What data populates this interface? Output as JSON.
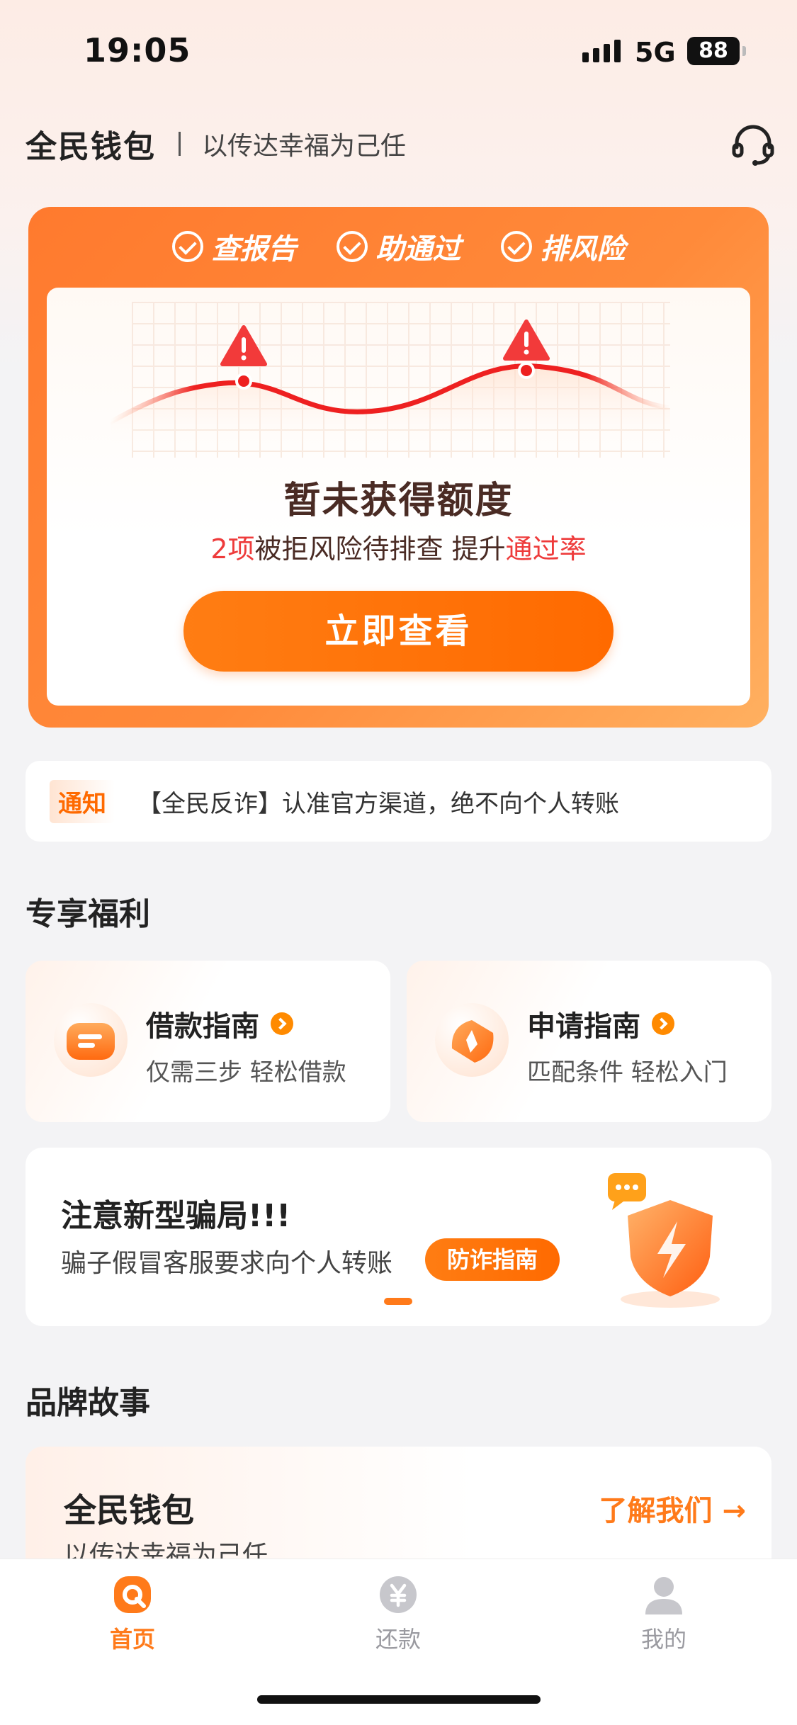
{
  "status_bar": {
    "time": "19:05",
    "network": "5G",
    "battery": "88"
  },
  "header": {
    "brand": "全民钱包",
    "slogan": "以传达幸福为己任",
    "icon": "headset-icon"
  },
  "hero": {
    "tabs": [
      "查报告",
      "助通过",
      "排风险"
    ],
    "title": "暂未获得额度",
    "sub_count": "2项",
    "sub_mid": "被拒风险待排查 提升",
    "sub_highlight": "通过率",
    "button": "立即查看"
  },
  "notice": {
    "tag": "通知",
    "text": "【全民反诈】认准官方渠道，绝不向个人转账"
  },
  "benefits": {
    "title": "专享福利",
    "items": [
      {
        "name": "借款指南",
        "desc": "仅需三步 轻松借款",
        "icon": "wallet-icon"
      },
      {
        "name": "申请指南",
        "desc": "匹配条件 轻松入门",
        "icon": "compass-icon"
      }
    ]
  },
  "alert": {
    "title": "注意新型骗局!!!",
    "desc": "骗子假冒客服要求向个人转账",
    "button": "防诈指南",
    "icon": "shield-icon"
  },
  "story": {
    "title": "品牌故事",
    "card_title": "全民钱包",
    "card_sub": "以传达幸福为己任",
    "link": "了解我们 →"
  },
  "tabbar": [
    {
      "label": "首页",
      "icon": "home-icon",
      "active": true
    },
    {
      "label": "还款",
      "icon": "repay-icon",
      "active": false
    },
    {
      "label": "我的",
      "icon": "profile-icon",
      "active": false
    }
  ],
  "colors": {
    "accent": "#ff7a1a",
    "danger": "#ee3b3b",
    "text": "#222222"
  }
}
